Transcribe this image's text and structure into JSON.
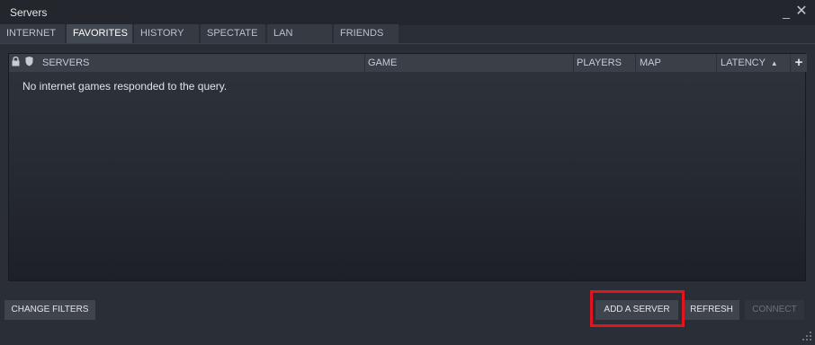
{
  "window": {
    "title": "Servers",
    "minimize_glyph": "_",
    "close_glyph": "✕"
  },
  "tabs": [
    {
      "label": "INTERNET",
      "active": false
    },
    {
      "label": "FAVORITES",
      "active": true
    },
    {
      "label": "HISTORY",
      "active": false
    },
    {
      "label": "SPECTATE",
      "active": false
    },
    {
      "label": "LAN",
      "active": false
    },
    {
      "label": "FRIENDS",
      "active": false
    }
  ],
  "list": {
    "columns": {
      "lock_icon": "lock-icon",
      "shield_icon": "shield-icon",
      "servers": "SERVERS",
      "game": "GAME",
      "players": "PLAYERS",
      "map": "MAP",
      "latency": "LATENCY",
      "sort_glyph": "▲"
    },
    "add_column_glyph": "+",
    "empty_message": "No internet games responded to the query."
  },
  "buttons": {
    "change_filters": "CHANGE FILTERS",
    "add_server": "ADD A SERVER",
    "refresh": "REFRESH",
    "connect": "CONNECT"
  },
  "colors": {
    "highlight": "#e0151e",
    "active_tab": "#434953"
  }
}
